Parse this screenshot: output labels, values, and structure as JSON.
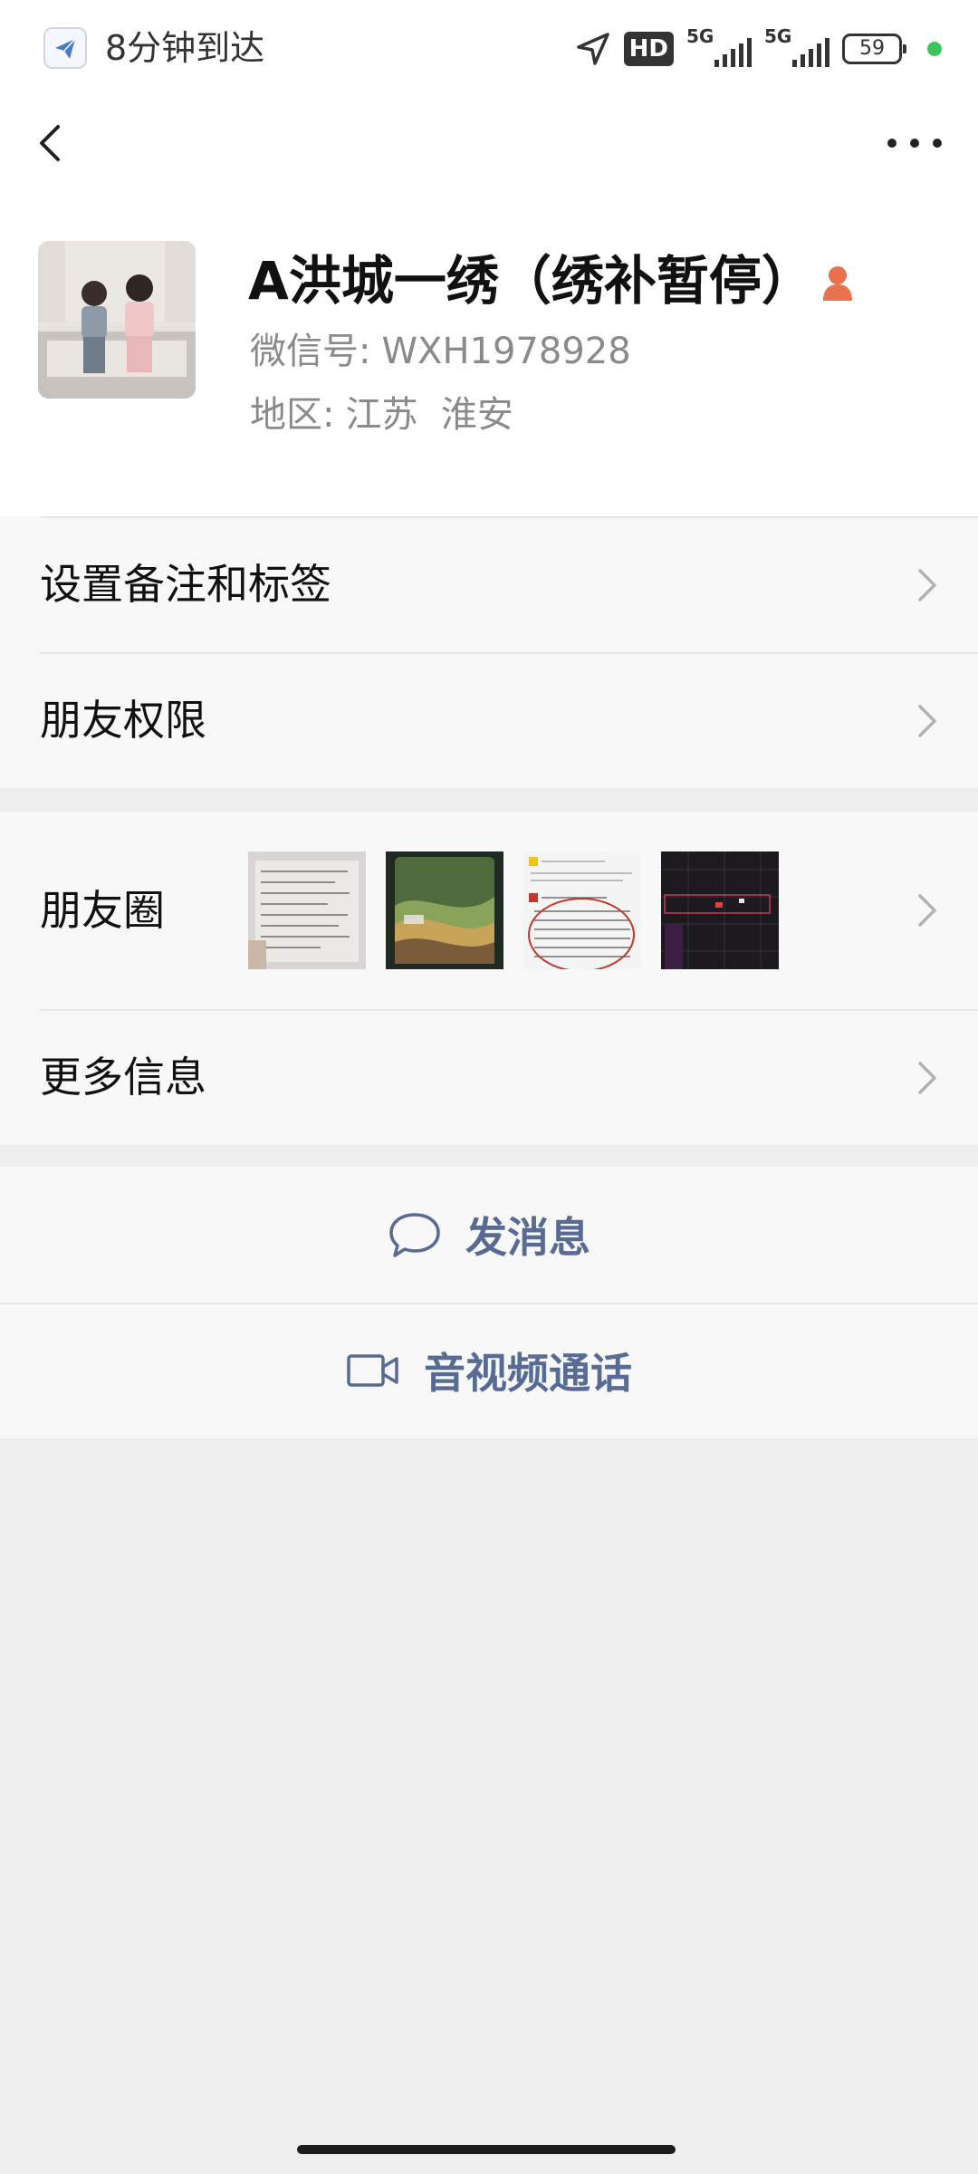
{
  "status_bar": {
    "delivery_text": "8分钟到达",
    "hd_label": "HD",
    "sim1_label": "5G",
    "sim2_label": "5G",
    "battery": "59"
  },
  "nav": {
    "back_icon": "chevron-left-icon",
    "more_icon": "more-dots-icon"
  },
  "profile": {
    "name": "A洪城一绣（绣补暂停）",
    "wechat_id_label": "微信号:",
    "wechat_id": "WXH1978928",
    "region_label": "地区:",
    "region": "江苏  淮安",
    "gender_icon": "female-icon",
    "gender_color": "#e9714f"
  },
  "list": {
    "remark": "设置备注和标签",
    "permissions": "朋友权限",
    "moments": "朋友圈",
    "more_info": "更多信息"
  },
  "actions": {
    "message": "发消息",
    "video_call": "音视频通话"
  },
  "colors": {
    "link_blue": "#576b95",
    "background": "#ededed",
    "cell_background": "#f8f8f8"
  }
}
